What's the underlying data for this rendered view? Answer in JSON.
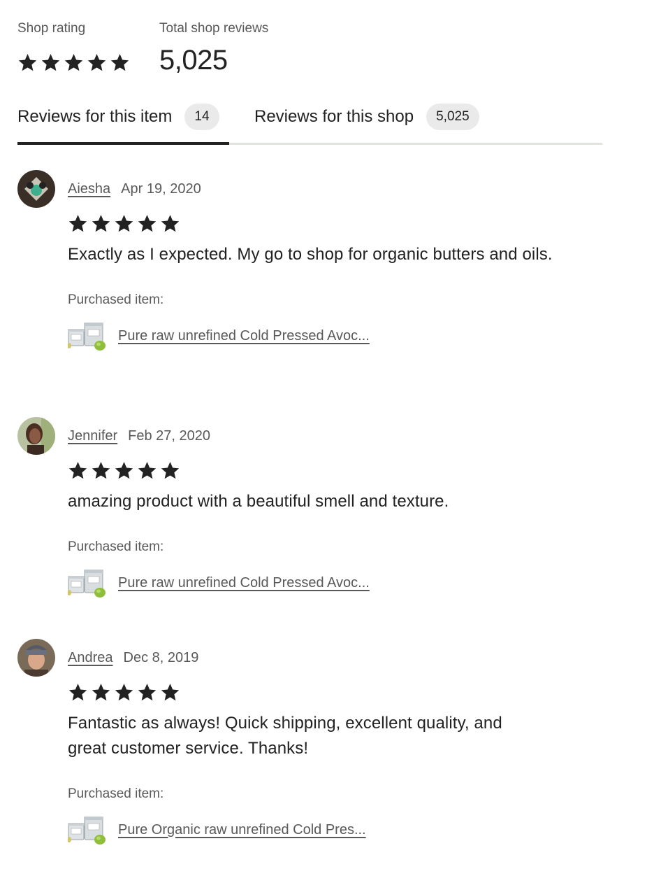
{
  "summary": {
    "rating_label": "Shop rating",
    "rating_stars": 5,
    "total_label": "Total shop reviews",
    "total_value": "5,025"
  },
  "tabs": [
    {
      "label": "Reviews for this item",
      "count": "14",
      "active": true
    },
    {
      "label": "Reviews for this shop",
      "count": "5,025",
      "active": false
    }
  ],
  "reviews": [
    {
      "name": "Aiesha",
      "date": "Apr 19, 2020",
      "stars": 5,
      "text": "Exactly as I expected. My go to shop for organic butters and oils.",
      "purchased_label": "Purchased item:",
      "item": "Pure raw unrefined Cold Pressed Avoc..."
    },
    {
      "name": "Jennifer",
      "date": "Feb 27, 2020",
      "stars": 5,
      "text": "amazing product with a beautiful smell and texture.",
      "purchased_label": "Purchased item:",
      "item": "Pure raw unrefined Cold Pressed Avoc..."
    },
    {
      "name": "Andrea",
      "date": "Dec 8, 2019",
      "stars": 5,
      "text": "Fantastic as always! Quick shipping, excellent quality, and great customer service. Thanks!",
      "purchased_label": "Purchased item:",
      "item": "Pure Organic raw unrefined Cold Pres..."
    }
  ],
  "colors": {
    "text": "#222222",
    "muted": "#595959",
    "badge": "#eaeaea",
    "divider": "#e1e3df",
    "star": "#222222"
  },
  "icons": {
    "star": "star-icon"
  }
}
